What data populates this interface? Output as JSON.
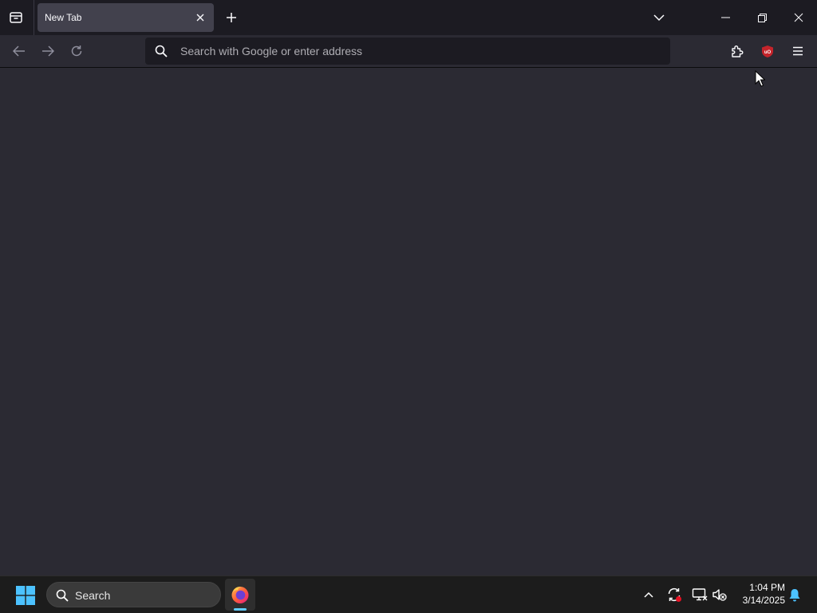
{
  "browser": {
    "tabs": [
      {
        "title": "New Tab",
        "active": true
      }
    ],
    "urlbar": {
      "placeholder": "Search with Google or enter address",
      "value": ""
    },
    "icons": {
      "tab_list": "firefox-view-icon",
      "tab_close": "close-icon",
      "new_tab": "plus-icon",
      "list_all_tabs": "chevron-down-icon",
      "back": "arrow-left-icon",
      "forward": "arrow-right-icon",
      "reload": "reload-icon",
      "search": "search-icon",
      "extensions": "puzzle-icon",
      "ublock": "ublock-origin-icon",
      "menu": "hamburger-menu-icon"
    }
  },
  "taskbar": {
    "search_label": "Search",
    "clock": {
      "time": "1:04 PM",
      "date": "3/14/2025"
    },
    "apps": [
      "Firefox"
    ]
  },
  "colors": {
    "chrome_bg": "#1c1b22",
    "toolbar_bg": "#2b2a33",
    "tab_bg": "#42414d",
    "accent": "#60cdff",
    "ublock_red": "#c4242b"
  }
}
